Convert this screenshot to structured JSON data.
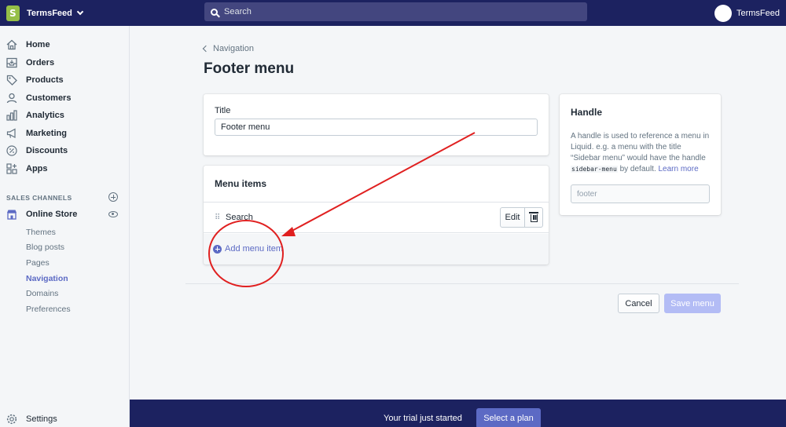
{
  "topbar": {
    "store_name": "TermsFeed",
    "search_placeholder": "Search",
    "user_name": "TermsFeed"
  },
  "sidebar": {
    "items": [
      {
        "label": "Home",
        "icon": "home-icon"
      },
      {
        "label": "Orders",
        "icon": "orders-icon"
      },
      {
        "label": "Products",
        "icon": "tag-icon"
      },
      {
        "label": "Customers",
        "icon": "person-icon"
      },
      {
        "label": "Analytics",
        "icon": "bar-chart-icon"
      },
      {
        "label": "Marketing",
        "icon": "megaphone-icon"
      },
      {
        "label": "Discounts",
        "icon": "discount-icon"
      },
      {
        "label": "Apps",
        "icon": "apps-icon"
      }
    ],
    "section_title": "SALES CHANNELS",
    "channel": {
      "label": "Online Store",
      "icon": "store-icon"
    },
    "sub_items": [
      "Themes",
      "Blog posts",
      "Pages",
      "Navigation",
      "Domains",
      "Preferences"
    ],
    "active_sub_item": "Navigation",
    "settings_label": "Settings"
  },
  "page": {
    "breadcrumb": "Navigation",
    "title": "Footer menu"
  },
  "title_card": {
    "label": "Title",
    "value": "Footer menu"
  },
  "menu_card": {
    "heading": "Menu items",
    "items": [
      {
        "label": "Search"
      }
    ],
    "edit_label": "Edit",
    "add_label": "Add menu item"
  },
  "handle_card": {
    "heading": "Handle",
    "desc_before": "A handle is used to reference a menu in Liquid. e.g. a menu with the title “Sidebar menu” would have the handle ",
    "code": "sidebar-menu",
    "desc_after": " by default.",
    "learn_more": "Learn more",
    "value": "footer"
  },
  "actions": {
    "cancel": "Cancel",
    "save": "Save menu"
  },
  "trial": {
    "text": "Your trial just started",
    "button": "Select a plan"
  },
  "colors": {
    "topbar": "#1c2260",
    "accent": "#5c6ac4",
    "annotation": "#e02020"
  }
}
